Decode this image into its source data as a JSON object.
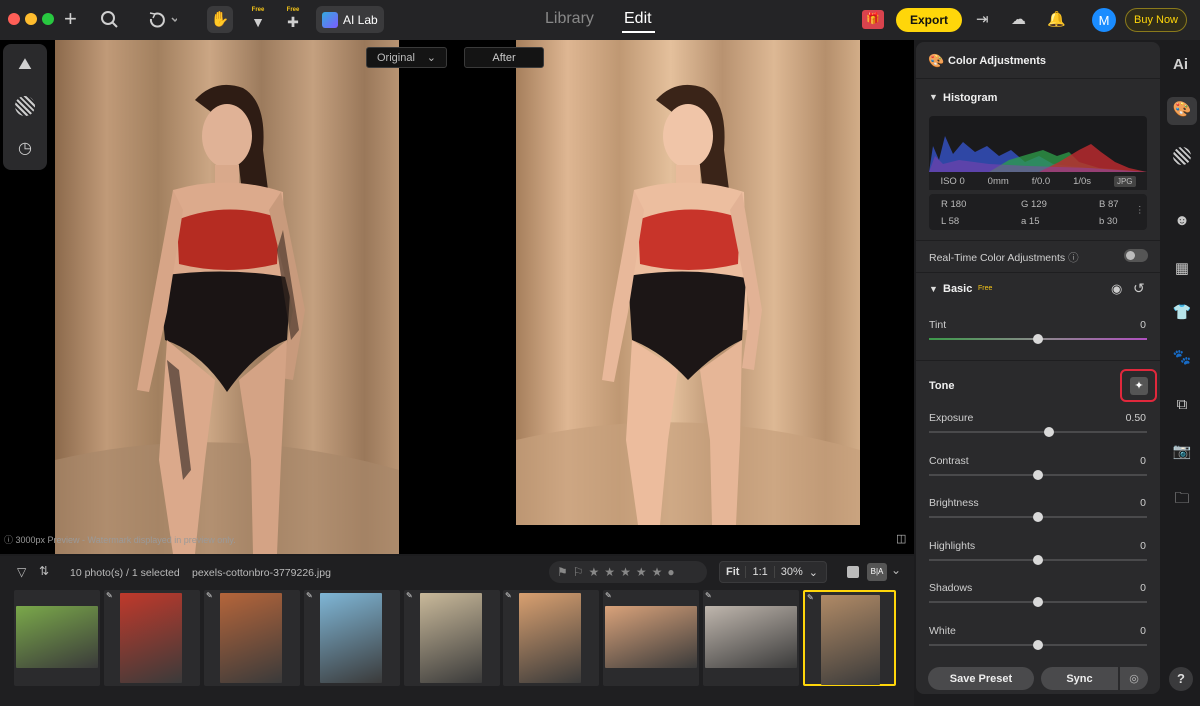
{
  "topbar": {
    "tabs": [
      {
        "label": "Library"
      },
      {
        "label": "Edit"
      }
    ],
    "ai_lab_label": "AI Lab",
    "free_badge": "Free",
    "export_label": "Export",
    "buy_label": "Buy Now",
    "avatar_letter": "M"
  },
  "canvas": {
    "view_select": "Original",
    "after_label": "After",
    "preview_note": "3000px Preview - Watermark displayed in preview only."
  },
  "filmstrip": {
    "count_text": "10 photo(s) / 1 selected",
    "filename": "pexels-cottonbro-3779226.jpg",
    "zoom_fit": "Fit",
    "zoom_1to1": "1:1",
    "zoom_percent": "30%",
    "ba_label": "B|A",
    "rating_stars": 0,
    "thumbnails": [
      {
        "name": "puppies",
        "color": "#7aa84a"
      },
      {
        "name": "red-building-harbor",
        "color": "#c0392b"
      },
      {
        "name": "narrow-alley",
        "color": "#b5653a"
      },
      {
        "name": "city-tower",
        "color": "#7fb6d6"
      },
      {
        "name": "crowded-beach",
        "color": "#c9b99a"
      },
      {
        "name": "sunset-sea-person",
        "color": "#d9a070"
      },
      {
        "name": "hot-air-balloons",
        "color": "#d9a27a"
      },
      {
        "name": "family-portrait",
        "color": "#bfb6ad"
      },
      {
        "name": "woman-studio",
        "color": "#b08a66"
      }
    ]
  },
  "panel": {
    "title": "Color Adjustments",
    "histogram": {
      "title": "Histogram",
      "iso": "ISO 0",
      "focal": "0mm",
      "aperture": "f/0.0",
      "shutter": "1/0s",
      "format": "JPG",
      "r": "R 180",
      "g": "G 129",
      "b": "B 87",
      "l": "L 58",
      "a": "a 15",
      "b2": "b 30"
    },
    "realtime_label": "Real-Time Color Adjustments",
    "basic_title": "Basic",
    "basic_badge": "Free",
    "tint": {
      "label": "Tint",
      "value": "0",
      "level": 0.5
    },
    "tone_title": "Tone",
    "sliders": [
      {
        "label": "Exposure",
        "value": "0.50",
        "level": 0.55
      },
      {
        "label": "Contrast",
        "value": "0",
        "level": 0.5
      },
      {
        "label": "Brightness",
        "value": "0",
        "level": 0.5
      },
      {
        "label": "Highlights",
        "value": "0",
        "level": 0.5
      },
      {
        "label": "Shadows",
        "value": "0",
        "level": 0.5
      },
      {
        "label": "White",
        "value": "0",
        "level": 0.5
      }
    ],
    "save_preset_label": "Save Preset",
    "sync_label": "Sync"
  },
  "right_toolbar": {
    "ai_label": "Ai",
    "help_label": "?"
  },
  "colors": {
    "accent_yellow": "#ffd60a",
    "highlight_red": "#e0283c",
    "avatar_blue": "#1a8cff"
  }
}
